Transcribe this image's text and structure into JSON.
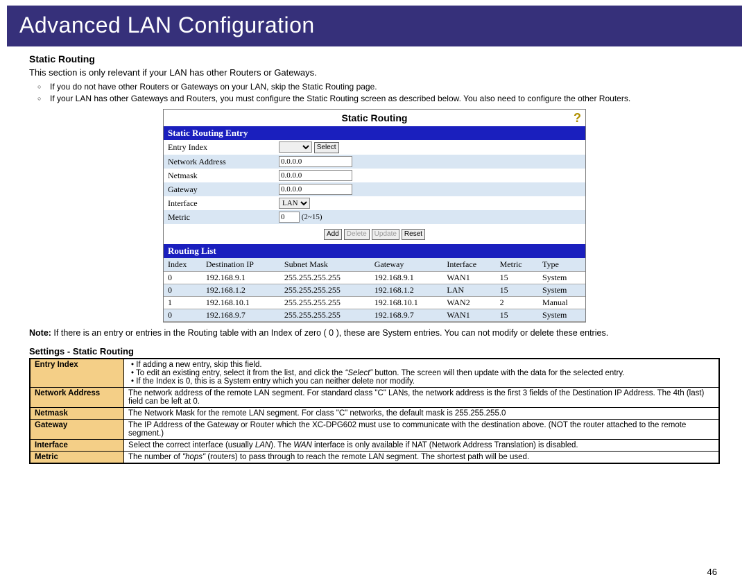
{
  "title": "Advanced LAN Configuration",
  "section1": {
    "heading": "Static Routing",
    "intro": "This section is only relevant if your LAN has other Routers or Gateways.",
    "bullets": [
      "If you do not have other Routers or Gateways on your LAN, skip the Static Routing page.",
      "If your LAN has other Gateways and Routers, you must configure the Static Routing screen as described below. You also need to configure the other Routers."
    ]
  },
  "panel": {
    "title": "Static Routing",
    "entry_heading": "Static Routing Entry",
    "labels": {
      "entry_index": "Entry Index",
      "network_address": "Network Address",
      "netmask": "Netmask",
      "gateway": "Gateway",
      "interface": "Interface",
      "metric": "Metric"
    },
    "values": {
      "network_address": "0.0.0.0",
      "netmask": "0.0.0.0",
      "gateway": "0.0.0.0",
      "interface": "LAN",
      "metric": "0",
      "metric_hint": "(2~15)"
    },
    "buttons": {
      "select": "Select",
      "add": "Add",
      "delete": "Delete",
      "update": "Update",
      "reset": "Reset"
    },
    "list_heading": "Routing List",
    "columns": {
      "index": "Index",
      "dest": "Destination IP",
      "mask": "Subnet Mask",
      "gateway": "Gateway",
      "iface": "Interface",
      "metric": "Metric",
      "type": "Type"
    },
    "rows": [
      {
        "index": "0",
        "dest": "192.168.9.1",
        "mask": "255.255.255.255",
        "gateway": "192.168.9.1",
        "iface": "WAN1",
        "metric": "15",
        "type": "System"
      },
      {
        "index": "0",
        "dest": "192.168.1.2",
        "mask": "255.255.255.255",
        "gateway": "192.168.1.2",
        "iface": "LAN",
        "metric": "15",
        "type": "System"
      },
      {
        "index": "1",
        "dest": "192.168.10.1",
        "mask": "255.255.255.255",
        "gateway": "192.168.10.1",
        "iface": "WAN2",
        "metric": "2",
        "type": "Manual"
      },
      {
        "index": "0",
        "dest": "192.168.9.7",
        "mask": "255.255.255.255",
        "gateway": "192.168.9.7",
        "iface": "WAN1",
        "metric": "15",
        "type": "System"
      }
    ]
  },
  "note": {
    "label": "Note:",
    "text": " If there is an entry or entries in the Routing table with an Index of zero ( 0 ), these are System entries. You can not modify or delete these entries."
  },
  "settings": {
    "heading": "Settings - Static Routing",
    "rows": [
      {
        "key": "Entry Index",
        "bullets": [
          "If adding a new entry, skip this field.",
          "To edit an existing entry, select it from the list, and click the “Select” button. The screen will then update with the data for the selected entry.",
          "If the Index is 0, this is a System entry which you can neither delete nor modify."
        ]
      },
      {
        "key": "Network Address",
        "text": "The network address of the remote LAN segment. For standard class \"C\" LANs, the network address is the first 3 fields of the Destination IP Address. The 4th (last) field can be left at 0."
      },
      {
        "key": "Netmask",
        "text": "The Network Mask for the remote LAN segment. For class \"C\" networks, the default mask is 255.255.255.0"
      },
      {
        "key": "Gateway",
        "text": "The IP Address of the Gateway or Router which the XC-DPG602 must use to communicate with the destination above. (NOT the router attached to the remote segment.)"
      },
      {
        "key": "Interface",
        "text_html": "Select the correct interface (usually <em>LAN</em>). The <em>WAN</em> interface is only available if NAT (Network Address Translation) is disabled."
      },
      {
        "key": "Metric",
        "text_html": "The number of <em>\"hops\"</em> (routers) to pass through to reach the remote LAN segment. The shortest path will be used."
      }
    ]
  },
  "page_number": "46"
}
